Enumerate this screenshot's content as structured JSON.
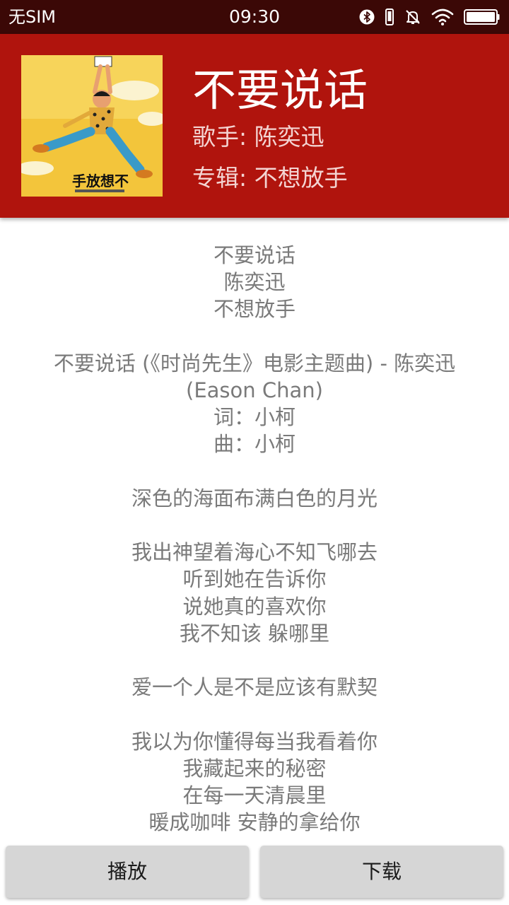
{
  "status_bar": {
    "carrier": "无SIM",
    "time": "09:30",
    "icons": [
      "bluetooth-icon",
      "vibrate-icon",
      "silent-icon",
      "wifi-icon",
      "battery-icon"
    ],
    "battery_level": 1.0
  },
  "song": {
    "title": "不要说话",
    "artist_line": "歌手: 陈奕迅",
    "album_line": "专辑: 不想放手"
  },
  "lyrics": [
    "不要说话",
    "陈奕迅",
    "不想放手",
    "",
    "不要说话 (《时尚先生》电影主题曲) - 陈奕迅 (Eason Chan)",
    "词：小柯",
    "曲：小柯",
    "",
    "深色的海面布满白色的月光",
    "",
    "我出神望着海心不知飞哪去",
    "听到她在告诉你",
    "说她真的喜欢你",
    "我不知该 躲哪里",
    "",
    "爱一个人是不是应该有默契",
    "",
    "我以为你懂得每当我看着你",
    "我藏起来的秘密",
    "在每一天清晨里",
    "暖成咖啡 安静的拿给你"
  ],
  "buttons": {
    "play": "播放",
    "download": "下载"
  },
  "colors": {
    "status_bar": "#3b0806",
    "header": "#b0140d",
    "lyrics_text": "#7a7a7a",
    "button_bg": "#d6d6d6"
  }
}
